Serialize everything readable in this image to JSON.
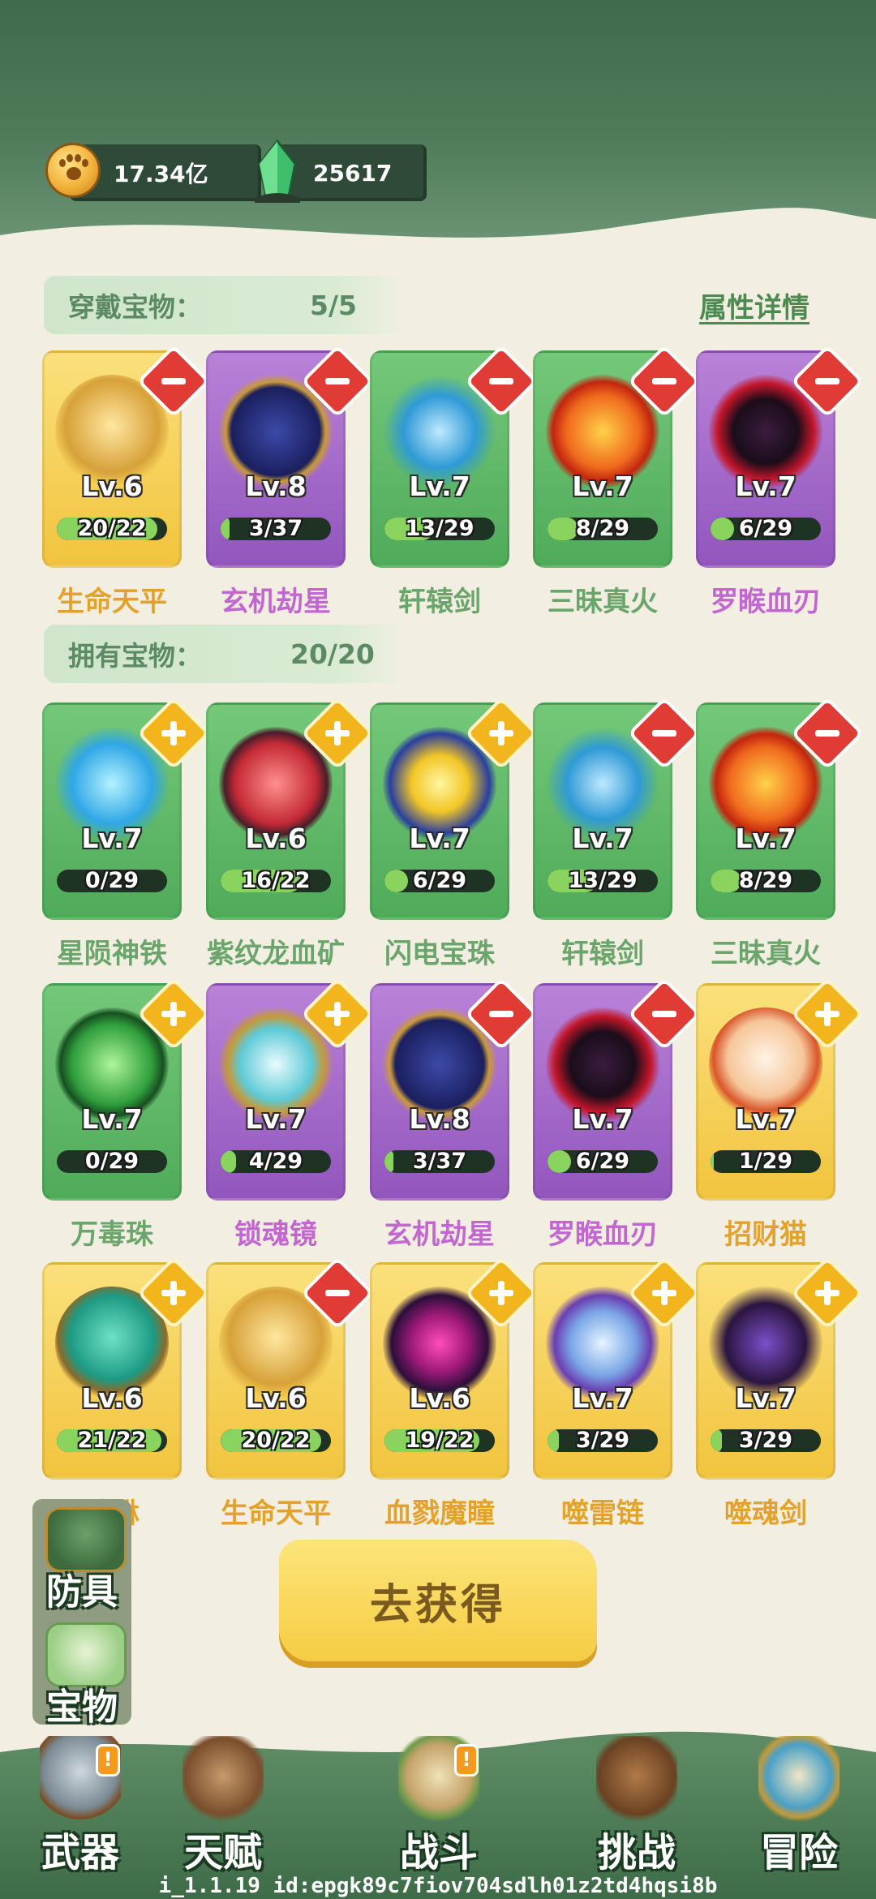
{
  "currencies": {
    "coins": {
      "icon": "paw-coin-icon",
      "value": "17.34亿"
    },
    "gems": {
      "icon": "green-crystal-icon",
      "value": "25617"
    }
  },
  "equipped": {
    "label": "穿戴宝物：",
    "count": "5/5",
    "attr_link": "属性详情",
    "items": [
      {
        "name": "生命天平",
        "level": "Lv.6",
        "progress": "20/22",
        "fraction": 0.91,
        "rarity": "gold",
        "badge": "minus",
        "art": "golden-scale-icon"
      },
      {
        "name": "玄机劫星",
        "level": "Lv.8",
        "progress": "3/37",
        "fraction": 0.08,
        "rarity": "purple",
        "badge": "minus",
        "art": "star-orb-icon"
      },
      {
        "name": "轩辕剑",
        "level": "Lv.7",
        "progress": "13/29",
        "fraction": 0.45,
        "rarity": "green",
        "badge": "minus",
        "art": "blue-sword-icon"
      },
      {
        "name": "三昧真火",
        "level": "Lv.7",
        "progress": "8/29",
        "fraction": 0.28,
        "rarity": "green",
        "badge": "minus",
        "art": "fire-orb-icon"
      },
      {
        "name": "罗睺血刃",
        "level": "Lv.7",
        "progress": "6/29",
        "fraction": 0.21,
        "rarity": "purple",
        "badge": "minus",
        "art": "blood-blade-icon"
      }
    ]
  },
  "owned": {
    "label": "拥有宝物：",
    "count": "20/20",
    "items": [
      {
        "name": "星陨神铁",
        "level": "Lv.7",
        "progress": "0/29",
        "fraction": 0.0,
        "rarity": "green",
        "badge": "plus",
        "art": "blue-crystal-icon"
      },
      {
        "name": "紫纹龙血矿",
        "level": "Lv.6",
        "progress": "16/22",
        "fraction": 0.73,
        "rarity": "green",
        "badge": "plus",
        "art": "red-crystal-icon"
      },
      {
        "name": "闪电宝珠",
        "level": "Lv.7",
        "progress": "6/29",
        "fraction": 0.21,
        "rarity": "green",
        "badge": "plus",
        "art": "lightning-orb-icon"
      },
      {
        "name": "轩辕剑",
        "level": "Lv.7",
        "progress": "13/29",
        "fraction": 0.45,
        "rarity": "green",
        "badge": "minus",
        "art": "blue-sword-icon"
      },
      {
        "name": "三昧真火",
        "level": "Lv.7",
        "progress": "8/29",
        "fraction": 0.28,
        "rarity": "green",
        "badge": "minus",
        "art": "fire-orb-icon"
      },
      {
        "name": "万毒珠",
        "level": "Lv.7",
        "progress": "0/29",
        "fraction": 0.0,
        "rarity": "green",
        "badge": "plus",
        "art": "poison-orb-icon"
      },
      {
        "name": "锁魂镜",
        "level": "Lv.7",
        "progress": "4/29",
        "fraction": 0.14,
        "rarity": "purple",
        "badge": "plus",
        "art": "yin-yang-mirror-icon"
      },
      {
        "name": "玄机劫星",
        "level": "Lv.8",
        "progress": "3/37",
        "fraction": 0.08,
        "rarity": "purple",
        "badge": "minus",
        "art": "star-orb-icon"
      },
      {
        "name": "罗睺血刃",
        "level": "Lv.7",
        "progress": "6/29",
        "fraction": 0.21,
        "rarity": "purple",
        "badge": "minus",
        "art": "blood-blade-icon"
      },
      {
        "name": "招财猫",
        "level": "Lv.7",
        "progress": "1/29",
        "fraction": 0.03,
        "rarity": "gold",
        "badge": "plus",
        "art": "lucky-cat-icon"
      },
      {
        "name": "貔貅",
        "level": "Lv.6",
        "progress": "21/22",
        "fraction": 0.95,
        "rarity": "gold",
        "badge": "plus",
        "art": "jade-beast-icon"
      },
      {
        "name": "生命天平",
        "level": "Lv.6",
        "progress": "20/22",
        "fraction": 0.91,
        "rarity": "gold",
        "badge": "minus",
        "art": "golden-scale-icon"
      },
      {
        "name": "血戮魔瞳",
        "level": "Lv.6",
        "progress": "19/22",
        "fraction": 0.86,
        "rarity": "gold",
        "badge": "plus",
        "art": "demon-eye-icon"
      },
      {
        "name": "噬雷链",
        "level": "Lv.7",
        "progress": "3/29",
        "fraction": 0.1,
        "rarity": "gold",
        "badge": "plus",
        "art": "thunder-chain-icon"
      },
      {
        "name": "噬魂剑",
        "level": "Lv.7",
        "progress": "3/29",
        "fraction": 0.1,
        "rarity": "gold",
        "badge": "plus",
        "art": "soul-sword-icon"
      }
    ]
  },
  "go_button": "去获得",
  "side_tabs": [
    {
      "label": "防具",
      "icon": "armor-icon"
    },
    {
      "label": "宝物",
      "icon": "treasure-icon"
    }
  ],
  "nav": [
    {
      "label": "武器",
      "icon": "axe-icon",
      "alert": "!"
    },
    {
      "label": "天赋",
      "icon": "talent-book-icon",
      "alert": ""
    },
    {
      "label": "战斗",
      "icon": "battle-scroll-icon",
      "alert": "!"
    },
    {
      "label": "挑战",
      "icon": "training-dummy-icon",
      "alert": ""
    },
    {
      "label": "冒险",
      "icon": "adventure-map-icon",
      "alert": ""
    }
  ],
  "build_id": "i_1.1.19 id:epgk89c7fiov704sdlh01z2td4hqsi8b",
  "colors": {
    "green_card": "#5bb964",
    "purple_card": "#a46bca",
    "gold_card": "#f5cf4f",
    "minus_badge": "#e03b35",
    "plus_badge": "#f2b51e"
  }
}
